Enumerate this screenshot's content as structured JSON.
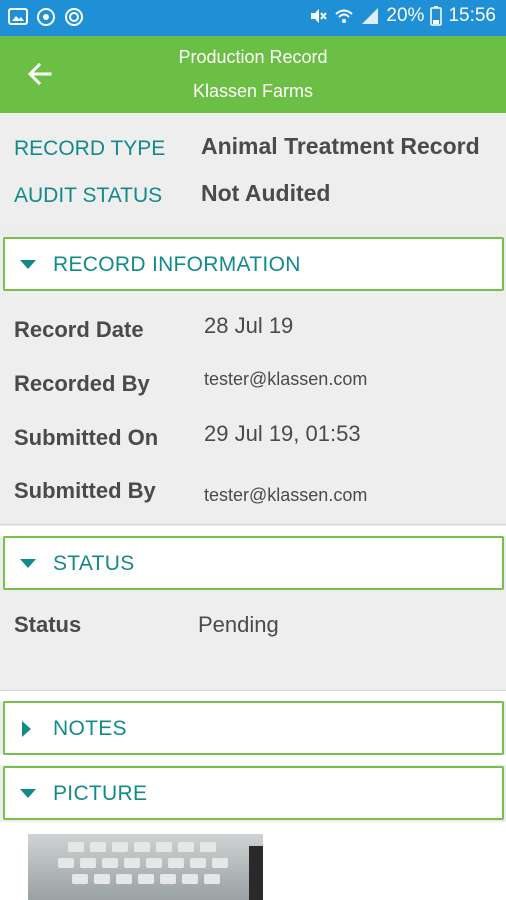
{
  "statusbar": {
    "battery": "20%",
    "time": "15:56"
  },
  "appbar": {
    "title": "Production Record",
    "subtitle": "Klassen Farms"
  },
  "summary": {
    "record_type_label": "RECORD TYPE",
    "record_type_value": "Animal Treatment Record",
    "audit_status_label": "AUDIT STATUS",
    "audit_status_value": "Not Audited"
  },
  "sections": {
    "record_information": {
      "title": "RECORD INFORMATION",
      "fields": [
        {
          "label": "Record Date",
          "value": "28 Jul 19"
        },
        {
          "label": "Recorded By",
          "value": "tester@klassen.com"
        },
        {
          "label": "Submitted On",
          "value": "29 Jul 19, 01:53"
        },
        {
          "label": "Submitted By",
          "value": "tester@klassen.com"
        }
      ]
    },
    "status": {
      "title": "STATUS",
      "fields": [
        {
          "label": "Status",
          "value": "Pending"
        }
      ]
    },
    "notes": {
      "title": "NOTES"
    },
    "picture": {
      "title": "PICTURE"
    }
  },
  "colors": {
    "statusbar": "#1f8fd6",
    "appbar": "#6cbf45",
    "accent": "#138a8a",
    "border": "#76c04c"
  },
  "icons": {
    "back": "arrow-left-icon",
    "expanded": "triangle-down-icon",
    "collapsed": "triangle-right-icon"
  }
}
